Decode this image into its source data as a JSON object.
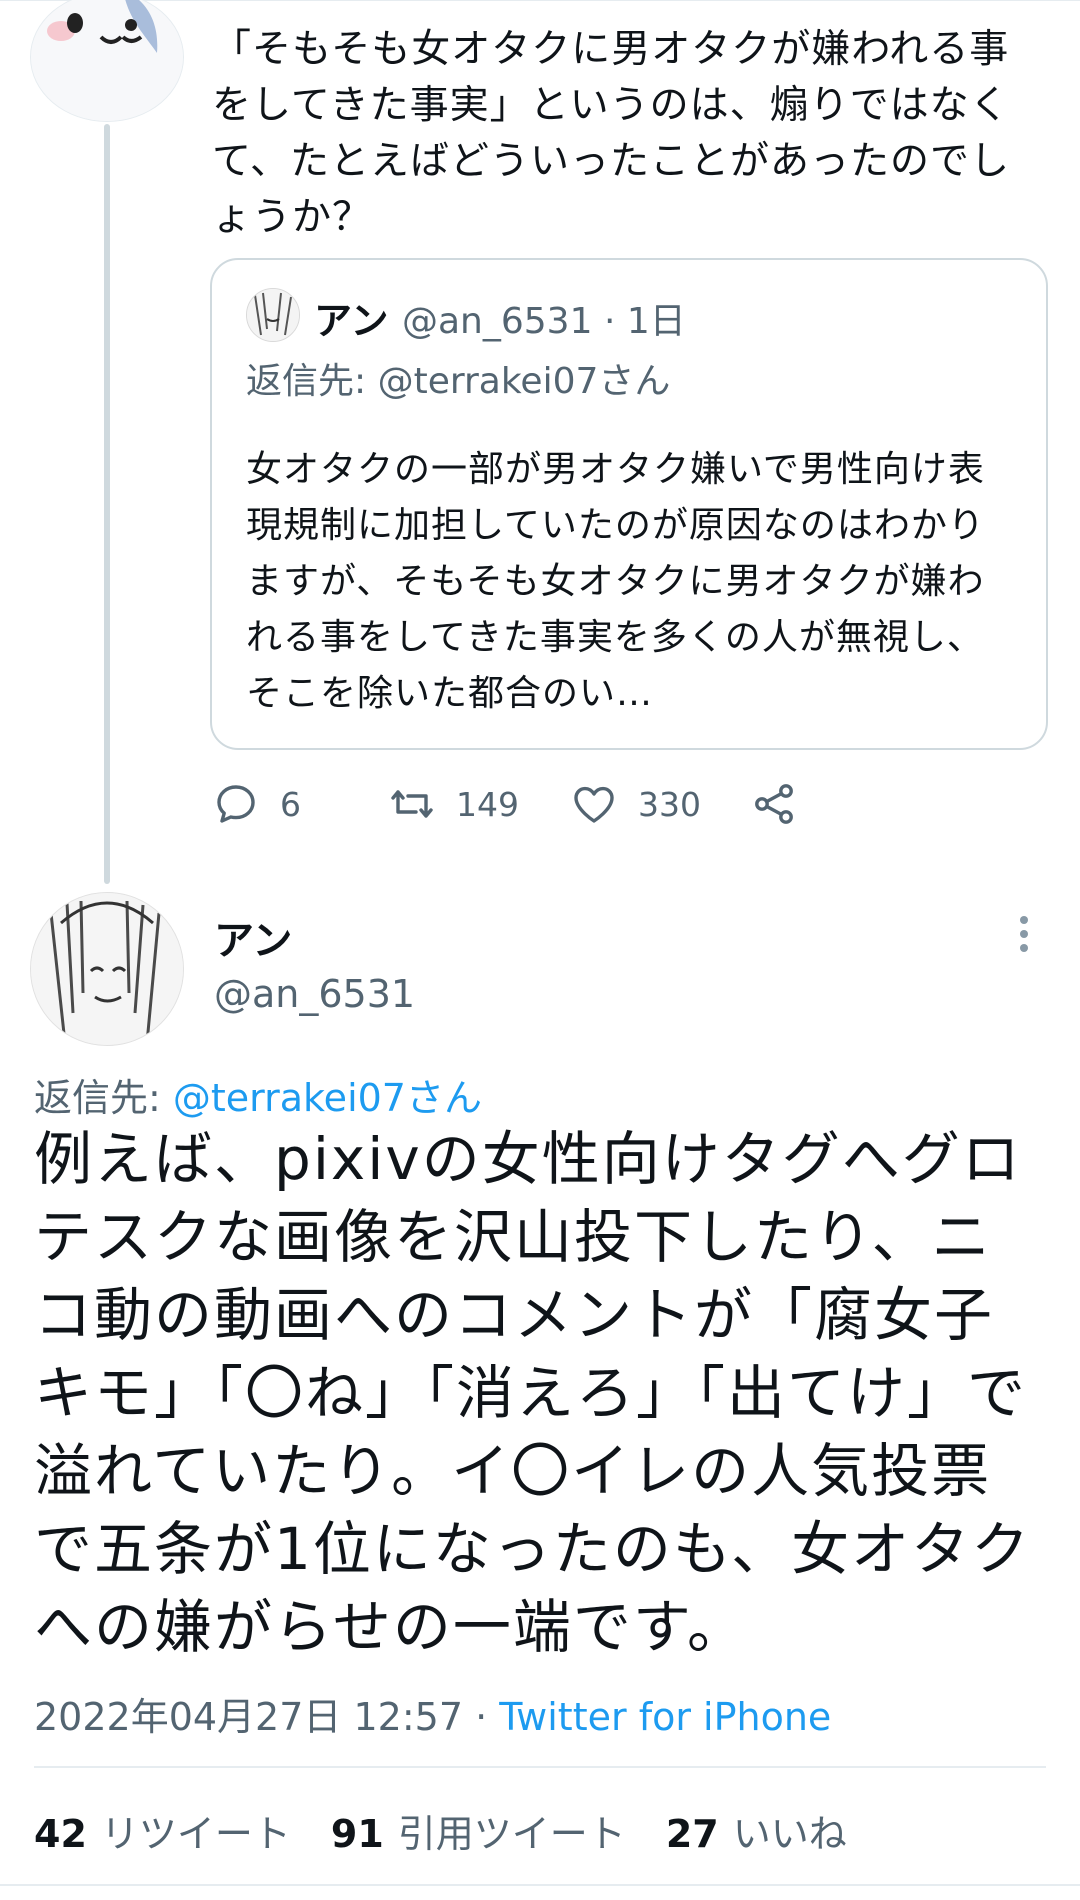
{
  "parent_tweet": {
    "text": "「そもそも女オタクに男オタクが嫌われる事をしてきた事実」というのは、煽りではなくて、たとえばどういったことがあったのでしょうか？"
  },
  "quote": {
    "name": "アン",
    "handle_time": "@an_6531 · 1日",
    "reply_to": "返信先: @terrakei07さん",
    "text": "女オタクの一部が男オタク嫌いで男性向け表現規制に加担していたのが原因なのはわかりますが、そもそも女オタクに男オタクが嫌われる事をしてきた事実を多くの人が無視し、そこを除いた都合のい…"
  },
  "actions": {
    "reply_count": "6",
    "retweet_count": "149",
    "like_count": "330"
  },
  "main_tweet": {
    "name": "アン",
    "handle": "@an_6531",
    "reply_prefix": "返信先: ",
    "reply_handle": "@terrakei07さん",
    "text": "例えば、pixivの女性向けタグへグロテスクな画像を沢山投下したり、ニコ動の動画へのコメントが「腐女子キモ」「〇ね」「消えろ」「出てけ」で溢れていたり。イ〇イレの人気投票で五条が1位になったのも、女オタクへの嫌がらせの一端です。",
    "timestamp": "2022年04月27日 12:57 · ",
    "source": "Twitter for iPhone"
  },
  "stats": {
    "retweets": "42",
    "retweets_label": "リツイート",
    "quotes": "91",
    "quotes_label": "引用ツイート",
    "likes": "27",
    "likes_label": "いいね"
  },
  "colors": {
    "accent": "#1d9bf0",
    "secondary_text": "#536471",
    "border": "#cfd9de"
  },
  "icons": [
    "reply-icon",
    "retweet-icon",
    "like-icon",
    "share-icon",
    "more-icon"
  ]
}
